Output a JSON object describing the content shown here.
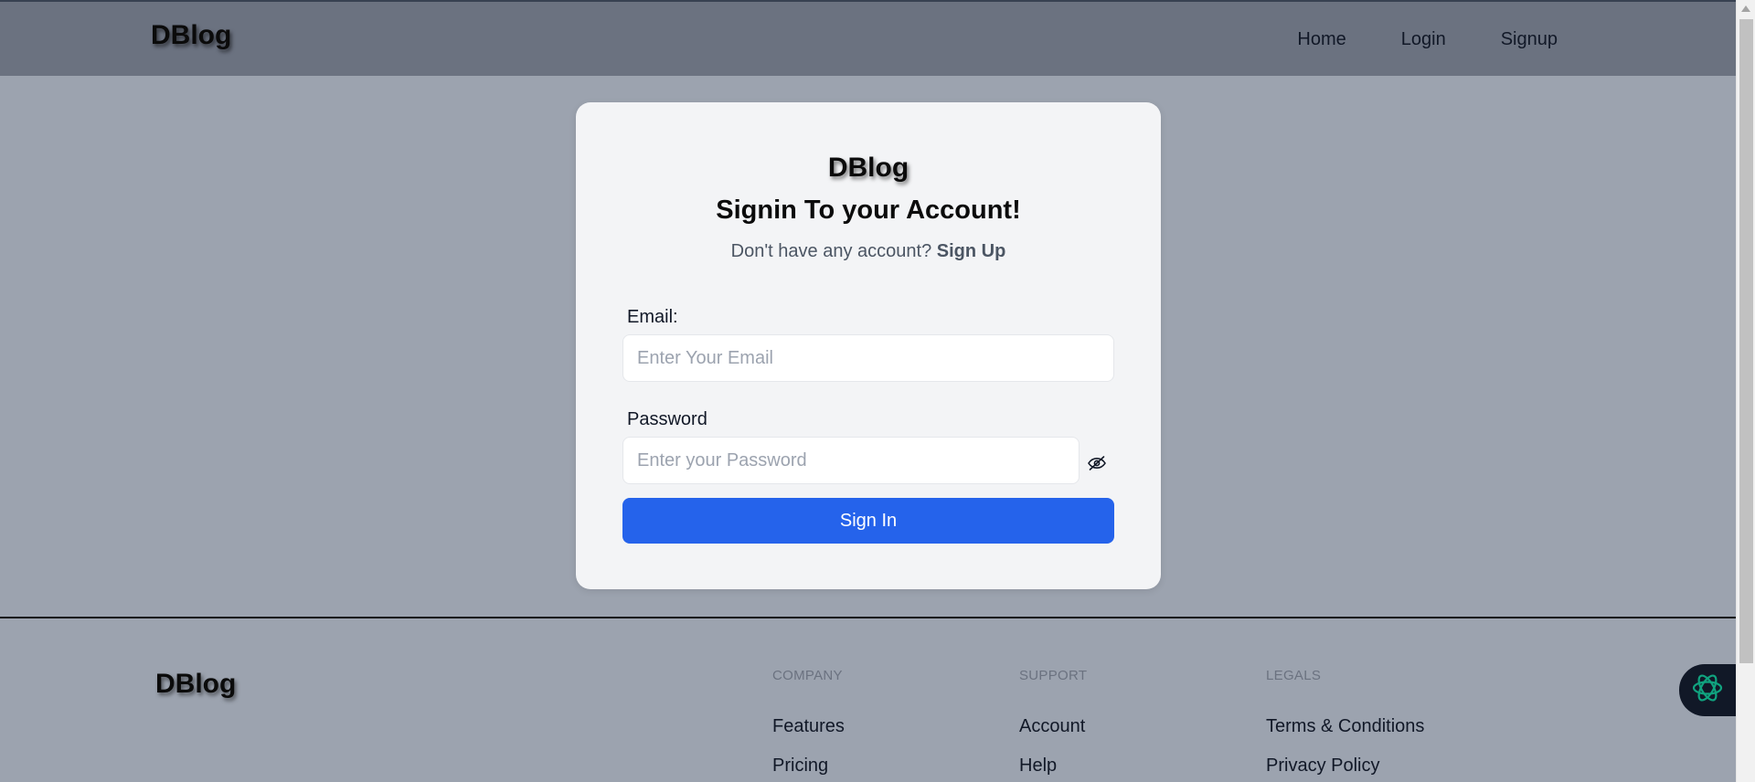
{
  "brand": "DBlog",
  "nav": {
    "links": [
      "Home",
      "Login",
      "Signup"
    ]
  },
  "signin": {
    "logo": "DBlog",
    "title": "Signin To your Account!",
    "subtitle_prefix": "Don't have any account?",
    "subtitle_link": "Sign Up",
    "email_label": "Email:",
    "email_placeholder": "Enter Your Email",
    "email_value": "",
    "password_label": "Password",
    "password_placeholder": "Enter your Password",
    "password_value": "",
    "password_toggle_icon": "eye-off-icon",
    "submit_label": "Sign In",
    "accent_color": "#2563eb"
  },
  "footer": {
    "logo": "DBlog",
    "columns": [
      {
        "heading": "COMPANY",
        "links": [
          "Features",
          "Pricing"
        ]
      },
      {
        "heading": "SUPPORT",
        "links": [
          "Account",
          "Help"
        ]
      },
      {
        "heading": "LEGALS",
        "links": [
          "Terms & Conditions",
          "Privacy Policy"
        ]
      }
    ]
  },
  "assistant": {
    "icon": "openai-logo-icon",
    "color": "#10a37f"
  }
}
